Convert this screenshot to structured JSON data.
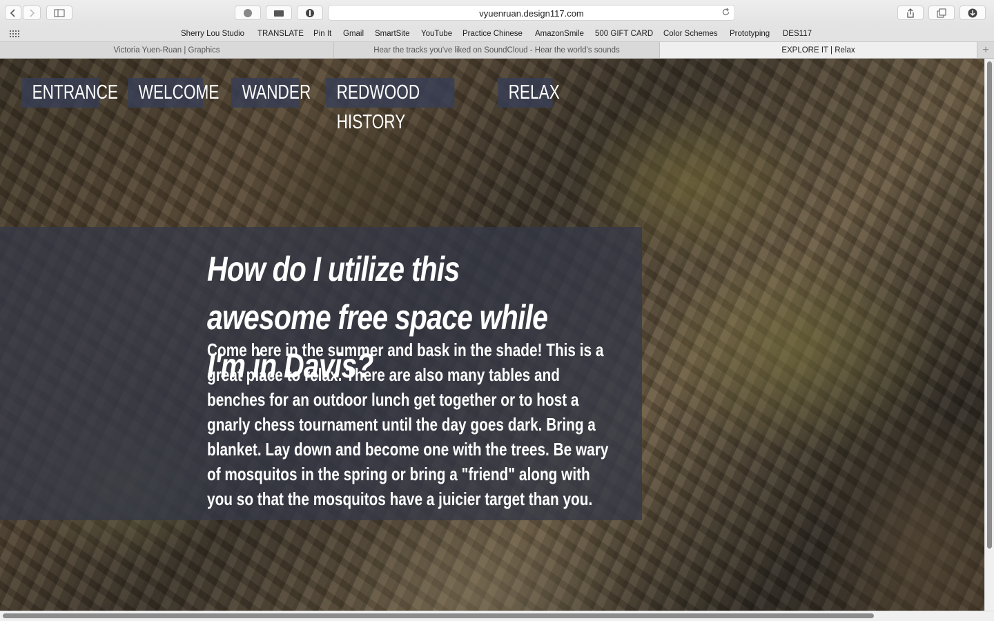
{
  "browser": {
    "url": "vyuenruan.design117.com",
    "bookmarks": [
      "Sherry Lou Studio",
      "TRANSLATE",
      "Pin It",
      "Gmail",
      "SmartSite",
      "YouTube",
      "Practice Chinese",
      "AmazonSmile",
      "500 GIFT CARD",
      "Color Schemes",
      "Prototyping",
      "DES117"
    ],
    "tabs": [
      "Victoria Yuen-Ruan | Graphics",
      "Hear the tracks you've liked on SoundCloud - Hear the world's sounds",
      "EXPLORE IT | Relax"
    ],
    "active_tab": 2
  },
  "nav": {
    "items": [
      "ENTRANCE",
      "WELCOME",
      "WANDER",
      "REDWOOD HISTORY",
      "RELAX"
    ]
  },
  "content": {
    "headline": "How do I utilize this awesome free space while I'm in Davis?",
    "body": "Come here in the summer and bask in the shade! This is a great place to relax. There are also many tables and benches for an outdoor lunch get together or to host a gnarly chess tournament until the day goes dark. Bring a blanket. Lay down and become one with the trees. Be wary of mosquitos in the spring or bring a \"friend\" along with you so that the mosquitos have a juicier target than you."
  },
  "colors": {
    "nav_bg": "#373e55",
    "panel_bg": "#343848",
    "text": "#ffffff"
  }
}
